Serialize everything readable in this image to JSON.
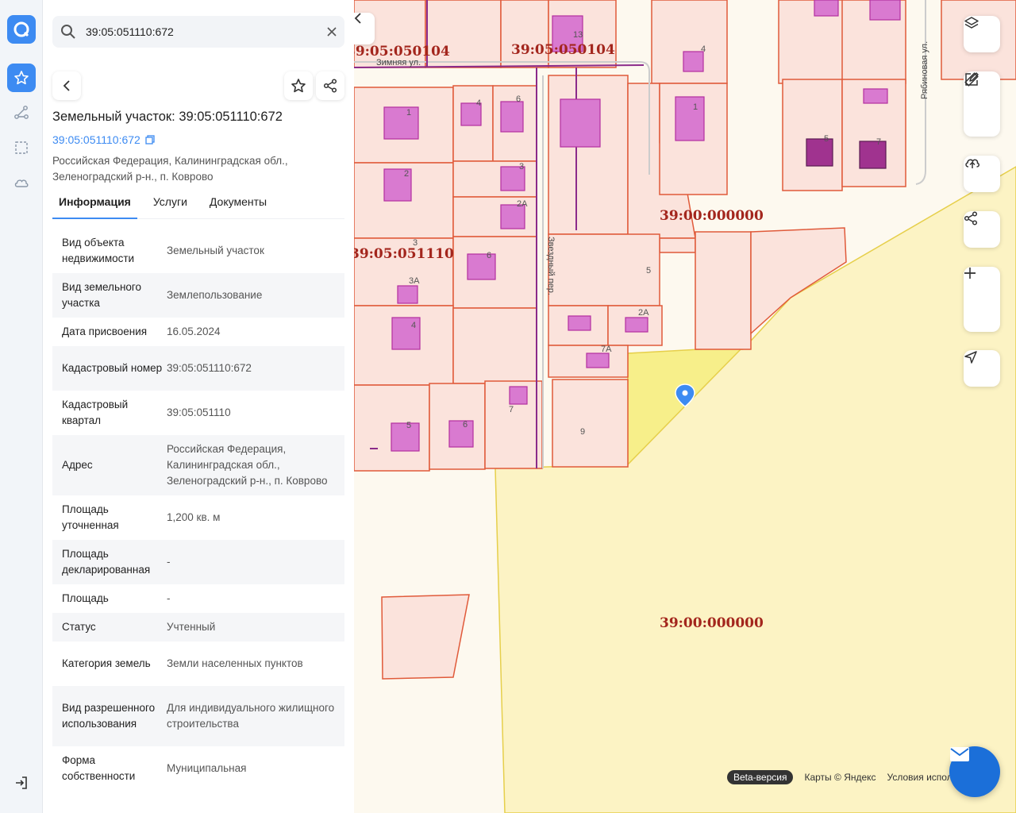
{
  "search": {
    "value": "39:05:051110:672"
  },
  "title": "Земельный участок: 39:05:051110:672",
  "cadastral_link": "39:05:051110:672",
  "address_lines": [
    "Российская Федерация, Калининградская обл.,",
    "Зеленоградский р-н., п. Коврово"
  ],
  "tabs": [
    {
      "label": "Информация",
      "active": true
    },
    {
      "label": "Услуги",
      "active": false
    },
    {
      "label": "Документы",
      "active": false
    }
  ],
  "info": [
    {
      "key": "Вид объекта недвижимости",
      "value": "Земельный участок"
    },
    {
      "key": "Вид земельного участка",
      "value": "Землепользование"
    },
    {
      "key": "Дата присвоения",
      "value": "16.05.2024"
    },
    {
      "key": "Кадастровый номер",
      "value": "39:05:051110:672"
    },
    {
      "key": "Кадастровый квартал",
      "value": "39:05:051110"
    },
    {
      "key": "Адрес",
      "value": "Российская Федерация, Калининградская обл., Зеленоградский р-н., п. Коврово"
    },
    {
      "key": "Площадь уточненная",
      "value": "1,200 кв. м"
    },
    {
      "key": "Площадь декларированная",
      "value": "-"
    },
    {
      "key": "Площадь",
      "value": "-"
    },
    {
      "key": "Статус",
      "value": "Учтенный"
    },
    {
      "key": "Категория земель",
      "value": "Земли населенных пунктов"
    },
    {
      "key": "Вид разрешенного использования",
      "value": "Для индивидуального жилищного строительства"
    },
    {
      "key": "Форма собственности",
      "value": "Муниципальная"
    }
  ],
  "map": {
    "quarter_labels": [
      "39:05:050104",
      "39:05:050104",
      "39:05:051110",
      "39:00:000000",
      "39:00:000000"
    ],
    "streets": [
      "Зимняя ул.",
      "Рябиновая ул.",
      "Звездный пер."
    ],
    "plot_numbers": [
      "13",
      "4",
      "1",
      "4",
      "6",
      "1",
      "2",
      "3",
      "2А",
      "6",
      "3",
      "3А",
      "4",
      "5",
      "2А",
      "7А",
      "5",
      "6",
      "7",
      "9",
      "5",
      "7"
    ],
    "footer": {
      "beta": "Beta-версия",
      "maps": "Карты © Яндекс",
      "terms": "Условия исполь"
    },
    "colors": {
      "accent": "#3d8bf2",
      "parcel_stroke": "#e05a3a",
      "parcel_fill": "#fbe3dc",
      "building": "#d97ad0",
      "highlight": "#f7ef8a"
    }
  }
}
